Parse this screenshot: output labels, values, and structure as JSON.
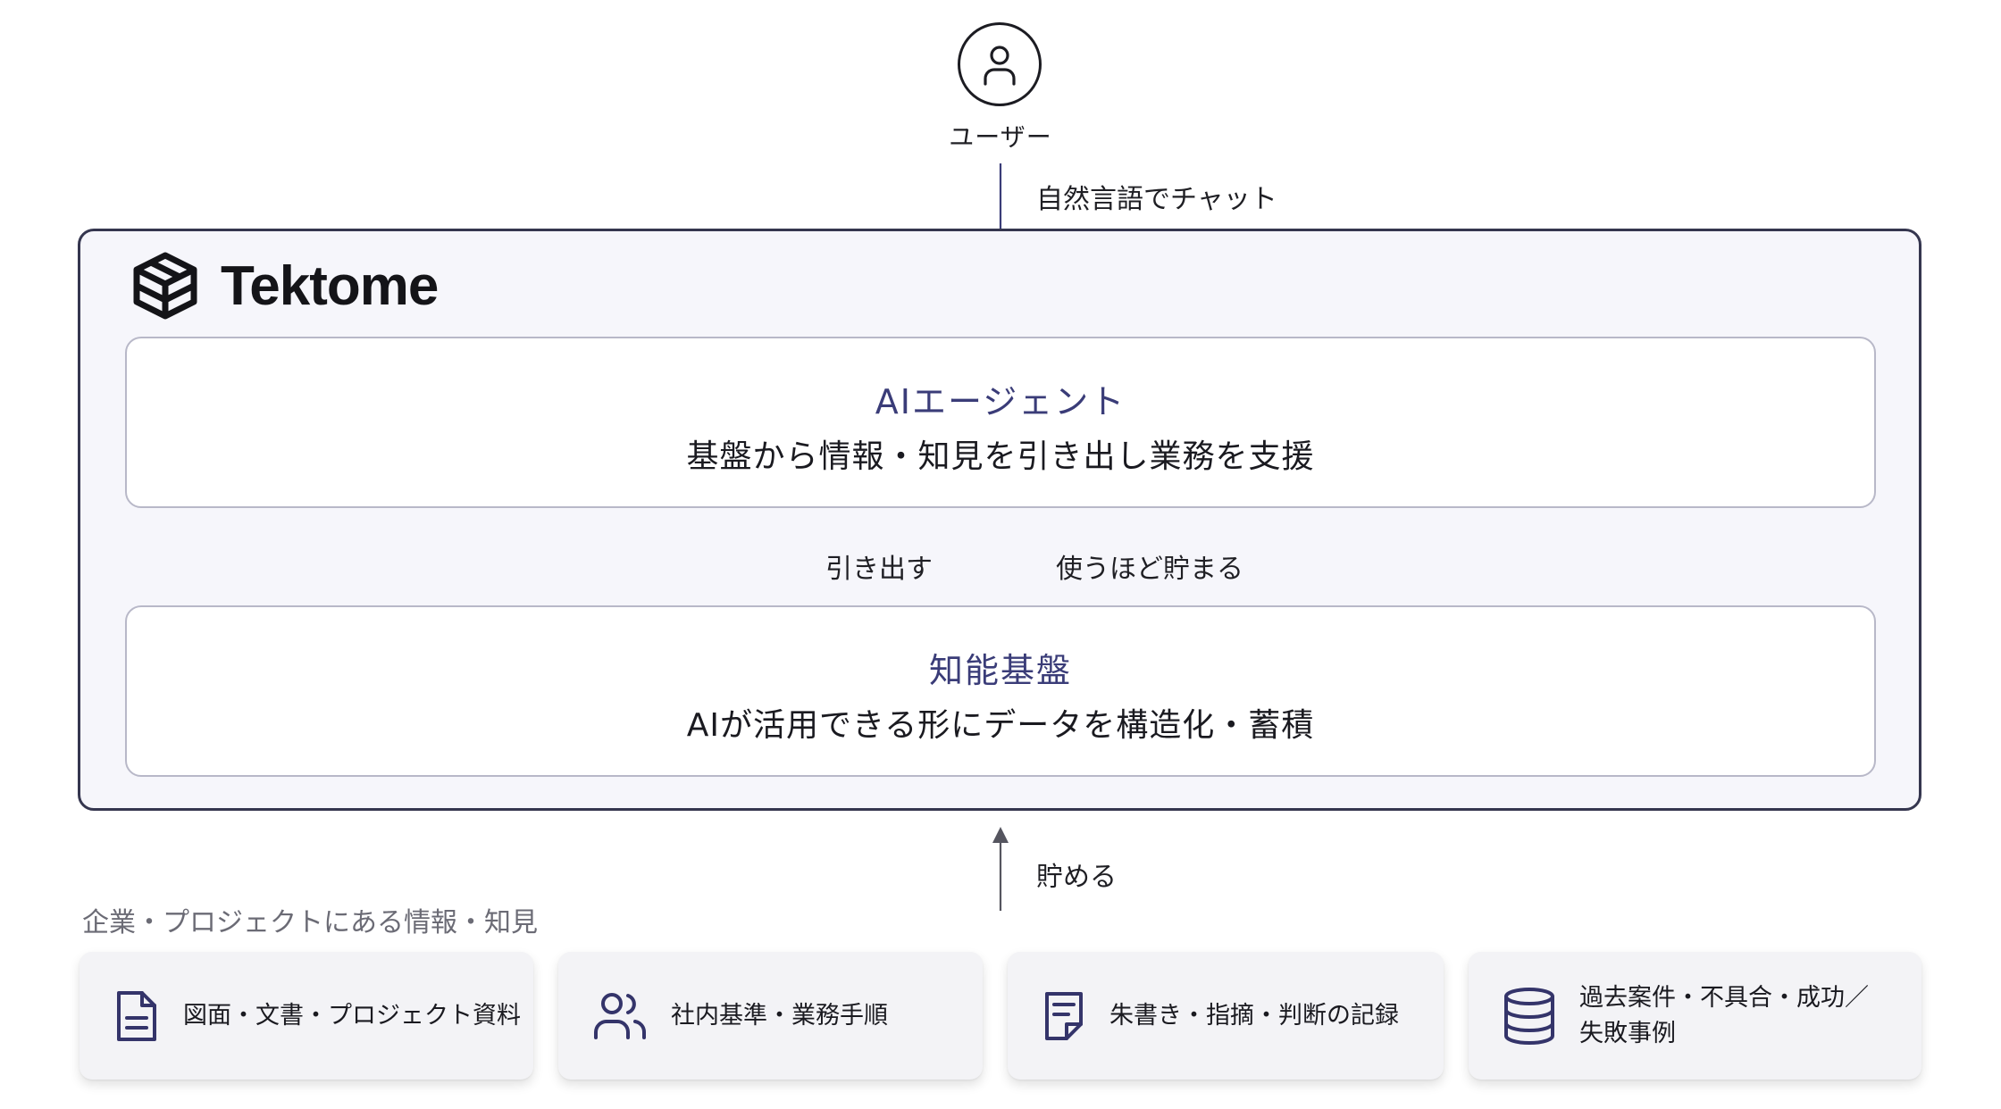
{
  "user": {
    "label": "ユーザー",
    "icon": "user-icon"
  },
  "arrows": {
    "chat_label": "自然言語でチャット",
    "extract_label": "引き出す",
    "accumulate_label": "使うほど貯まる",
    "store_label": "貯める"
  },
  "brand": {
    "name": "Tektome",
    "icon": "tektome-logo-icon"
  },
  "agent": {
    "title": "AIエージェント",
    "description": "基盤から情報・知見を引き出し業務を支援"
  },
  "base": {
    "title": "知能基盤",
    "description": "AIが活用できる形にデータを構造化・蓄積"
  },
  "sources": {
    "heading": "企業・プロジェクトにある情報・知見",
    "items": [
      {
        "label": "図面・文書・プロジェクト資料",
        "icon": "document-icon"
      },
      {
        "label": "社内基準・業務手順",
        "icon": "users-icon"
      },
      {
        "label": "朱書き・指摘・判断の記録",
        "icon": "note-icon"
      },
      {
        "label": "過去案件・不具合・成功／失敗事例",
        "icon": "database-icon"
      }
    ]
  },
  "colors": {
    "accent": "#3a3c78",
    "border": "#35364f",
    "panel": "#f6f6fb"
  }
}
